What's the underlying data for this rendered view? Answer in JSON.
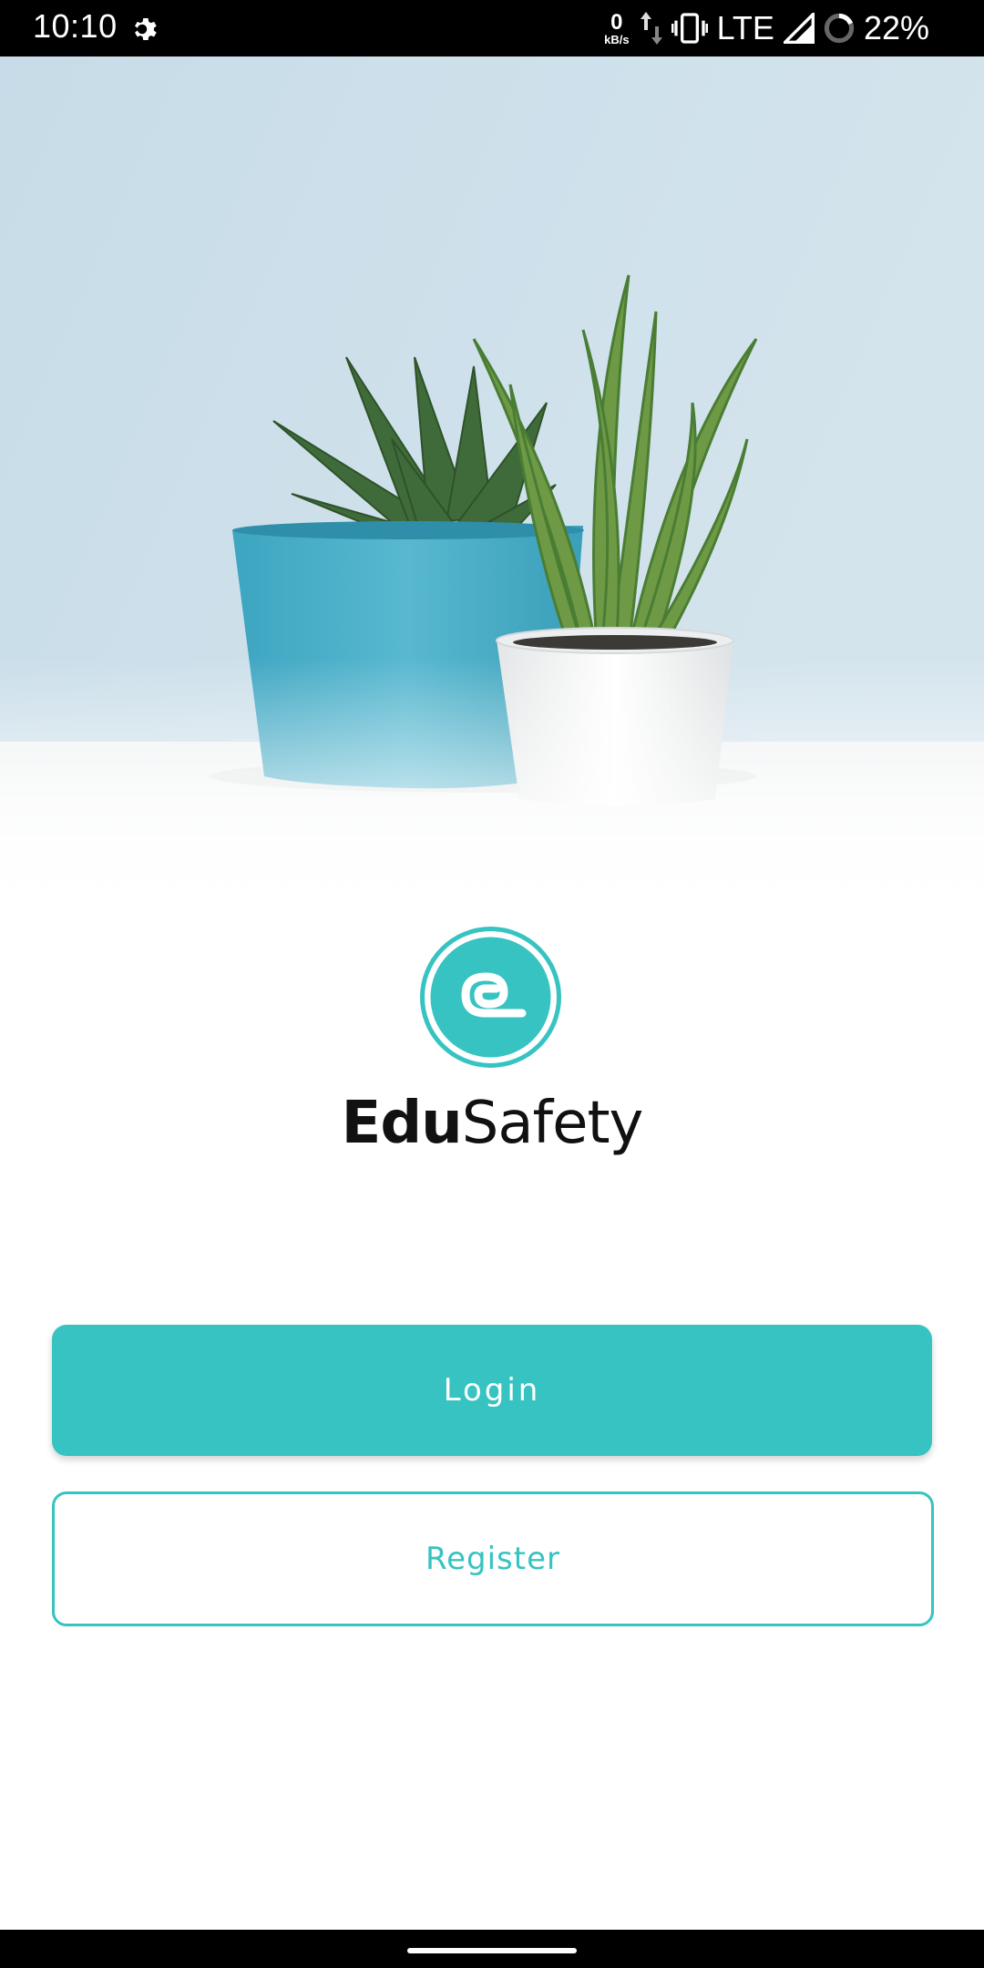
{
  "status_bar": {
    "time": "10:10",
    "data_rate_value": "0",
    "data_rate_unit": "kB/s",
    "network": "LTE",
    "battery": "22%",
    "icons": [
      "gear-icon",
      "data-arrows-icon",
      "vibrate-icon",
      "signal-icon",
      "battery-icon"
    ]
  },
  "brand": {
    "name_bold": "Edu",
    "name_regular": "Safety",
    "logo_icon": "edusafety-logo-icon",
    "accent_color": "#36c3c1"
  },
  "actions": {
    "login_label": "Login",
    "register_label": "Register"
  }
}
